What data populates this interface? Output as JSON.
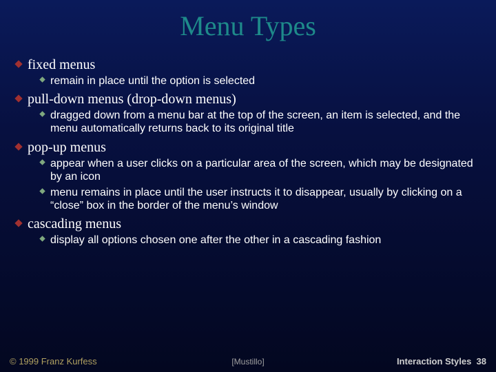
{
  "colors": {
    "title": "#1e8a8a",
    "bullet1": "#a03030",
    "bullet2": "#7fa87f",
    "footerLeft": "#b0a060",
    "footerCenter": "#a0a0a0",
    "footerRight": "#d0d0d0"
  },
  "title": "Menu Types",
  "items": [
    {
      "label": "fixed menus",
      "subs": [
        "remain in place until the option is selected"
      ]
    },
    {
      "label": "pull-down menus (drop-down menus)",
      "subs": [
        "dragged down from a menu bar at the top of the screen, an item is selected, and the menu automatically returns back to its original title"
      ]
    },
    {
      "label": "pop-up menus",
      "subs": [
        "appear when a user clicks on a particular area of the screen, which may be designated by an icon",
        "menu remains in place until the user instructs it to disappear, usually by clicking on a “close” box in the border of the menu’s window"
      ]
    },
    {
      "label": "cascading menus",
      "subs": [
        "display all options chosen one after the other in a cascading fashion"
      ]
    }
  ],
  "footer": {
    "left": "© 1999 Franz Kurfess",
    "center": "[Mustillo]",
    "rightPrefix": "Interaction Styles",
    "rightNumber": "38"
  }
}
